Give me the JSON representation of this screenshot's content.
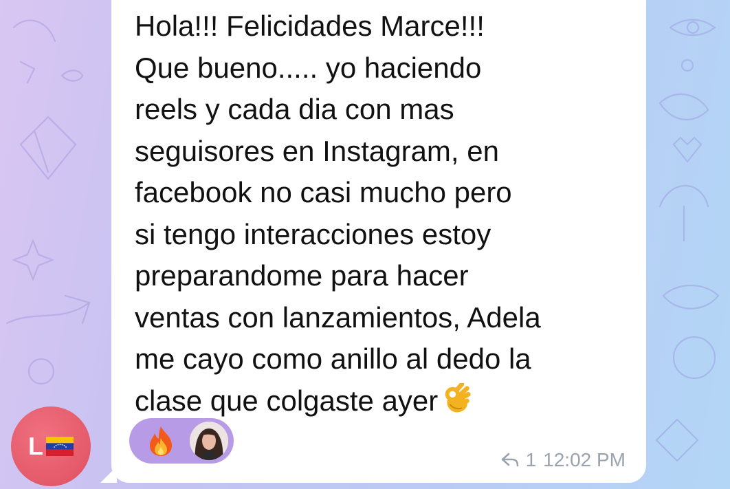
{
  "message": {
    "text": "Hola!!! Felicidades Marce!!!\nQue bueno..... yo haciendo\nreels y cada dia con mas\nseguisores en Instagram, en\nfacebook no casi mucho pero\nsi tengo interacciones estoy\npreparandome para hacer\nventas con lanzamientos, Adela\nme cayo como anillo al dedo la\nclase que colgaste ayer",
    "trailing_emoji": "ok-hand-emoji",
    "reactions": [
      {
        "emoji": "fire-icon",
        "reactor": "reactor-avatar"
      }
    ],
    "reply_count": "1",
    "time": "12:02 PM"
  },
  "sender": {
    "initial": "L",
    "flag": "venezuela-flag-icon"
  },
  "colors": {
    "bubble": "#ffffff",
    "reaction_pill": "#b79be6",
    "avatar": "#e45a6a",
    "meta_text": "#9aa2ae"
  }
}
